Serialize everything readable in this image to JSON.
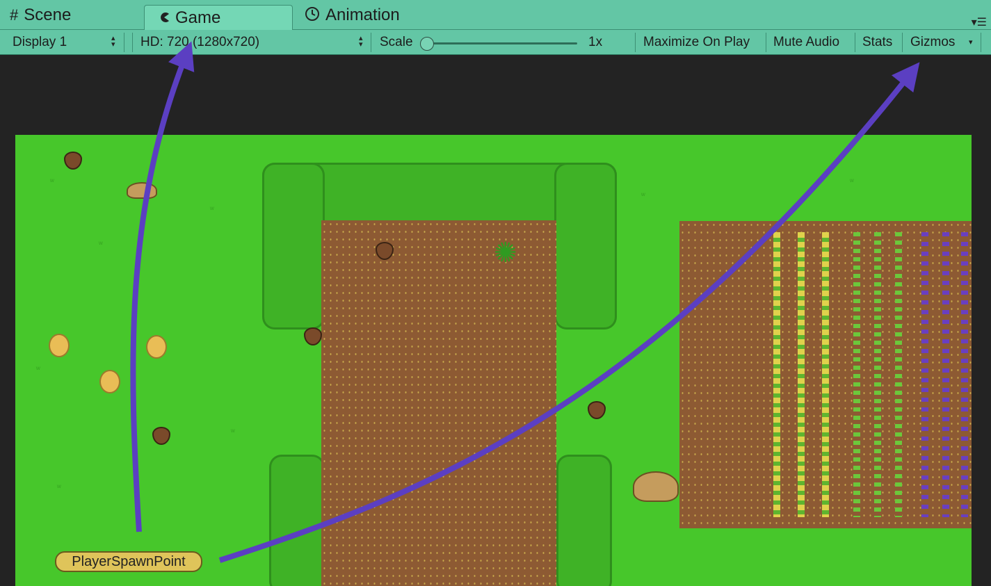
{
  "tabs": [
    {
      "label": "Scene",
      "icon": "grid-icon"
    },
    {
      "label": "Game",
      "icon": "pacman-icon",
      "active": true
    },
    {
      "label": "Animation",
      "icon": "clock-icon"
    }
  ],
  "toolbar": {
    "display": "Display 1",
    "resolution": "HD: 720 (1280x720)",
    "scale_label": "Scale",
    "scale_value": "1x",
    "maximize_on_play": "Maximize On Play",
    "mute_audio": "Mute Audio",
    "stats": "Stats",
    "gizmos": "Gizmos"
  },
  "game": {
    "spawn_label": "PlayerSpawnPoint"
  },
  "colors": {
    "editor_accent": "#63c6a5",
    "grass": "#47c72b",
    "dirt": "#8d5a33",
    "arrow": "#5b3fc2"
  }
}
